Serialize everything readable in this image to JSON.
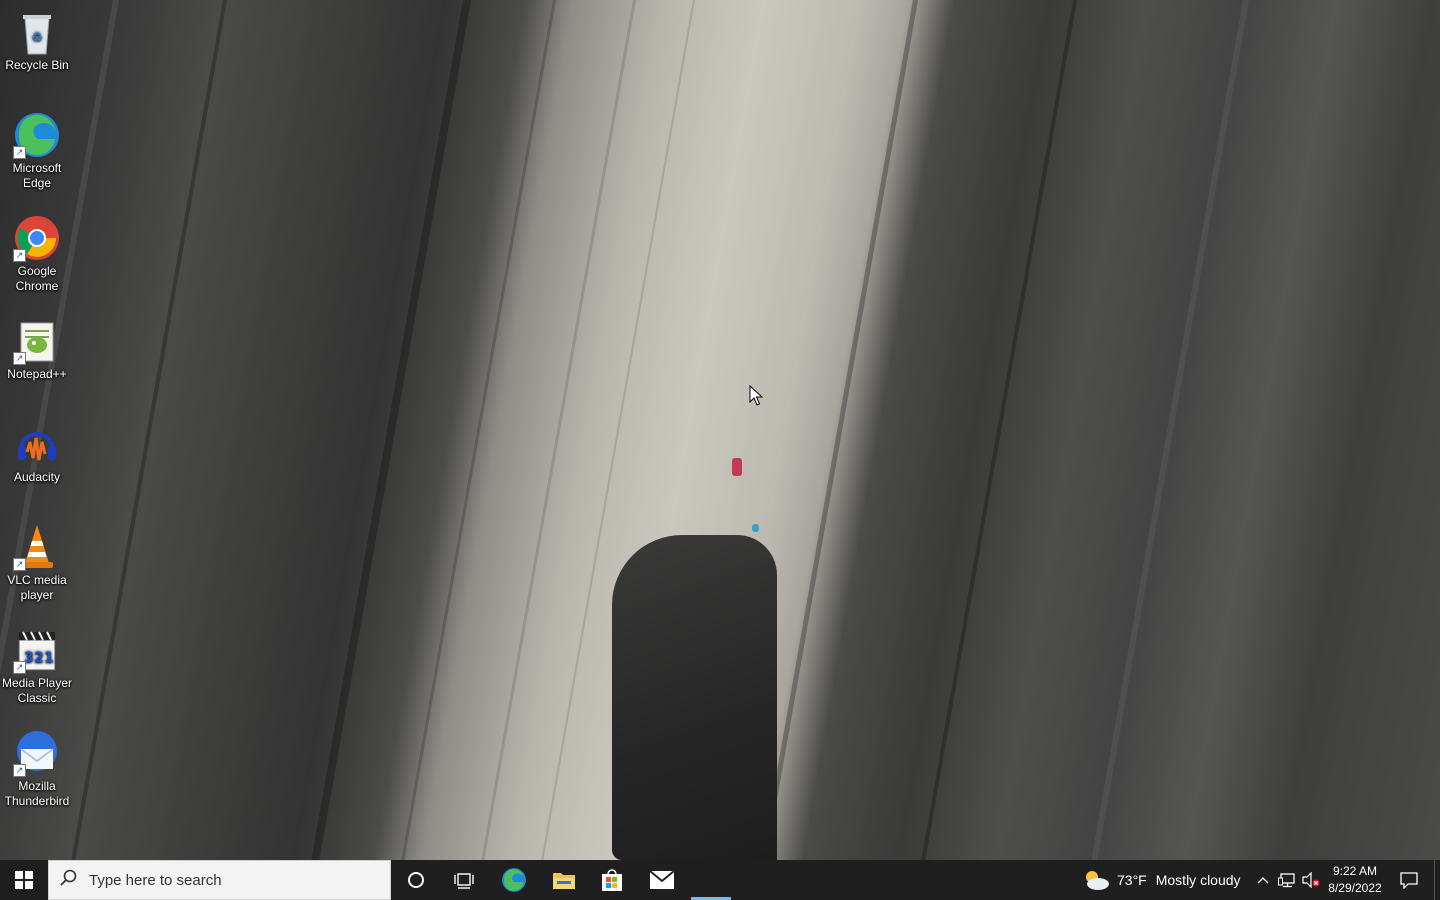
{
  "desktop": {
    "icons": [
      {
        "label": "Recycle Bin",
        "icon": "recycle-bin-icon"
      },
      {
        "label": "Microsoft Edge",
        "icon": "edge-icon"
      },
      {
        "label": "Google Chrome",
        "icon": "chrome-icon"
      },
      {
        "label": "Notepad++",
        "icon": "notepadpp-icon"
      },
      {
        "label": "Audacity",
        "icon": "audacity-icon"
      },
      {
        "label": "VLC media player",
        "icon": "vlc-icon"
      },
      {
        "label": "Media Player Classic",
        "icon": "mpc-icon"
      },
      {
        "label": "Mozilla Thunderbird",
        "icon": "thunderbird-icon"
      }
    ]
  },
  "taskbar": {
    "start_icon": "windows-start-icon",
    "search_placeholder": "Type here to search",
    "pinned": [
      {
        "name": "cortana",
        "icon": "cortana-circle-icon"
      },
      {
        "name": "task-view",
        "icon": "task-view-icon"
      },
      {
        "name": "edge",
        "icon": "edge-icon"
      },
      {
        "name": "file-explorer",
        "icon": "folder-icon"
      },
      {
        "name": "microsoft-store",
        "icon": "store-icon"
      },
      {
        "name": "mail",
        "icon": "mail-icon"
      }
    ],
    "weather": {
      "temp": "73°F",
      "condition": "Mostly cloudy",
      "icon": "partly-cloudy-icon"
    },
    "tray_icons": [
      "chevron-up-icon",
      "network-icon",
      "volume-muted-icon"
    ],
    "clock": {
      "time": "9:22 AM",
      "date": "8/29/2022"
    },
    "notification_icon": "action-center-icon"
  },
  "colors": {
    "taskbar": "#1f1f1f",
    "search_bg": "#f3f3f3",
    "accent": "#76b9ed"
  }
}
